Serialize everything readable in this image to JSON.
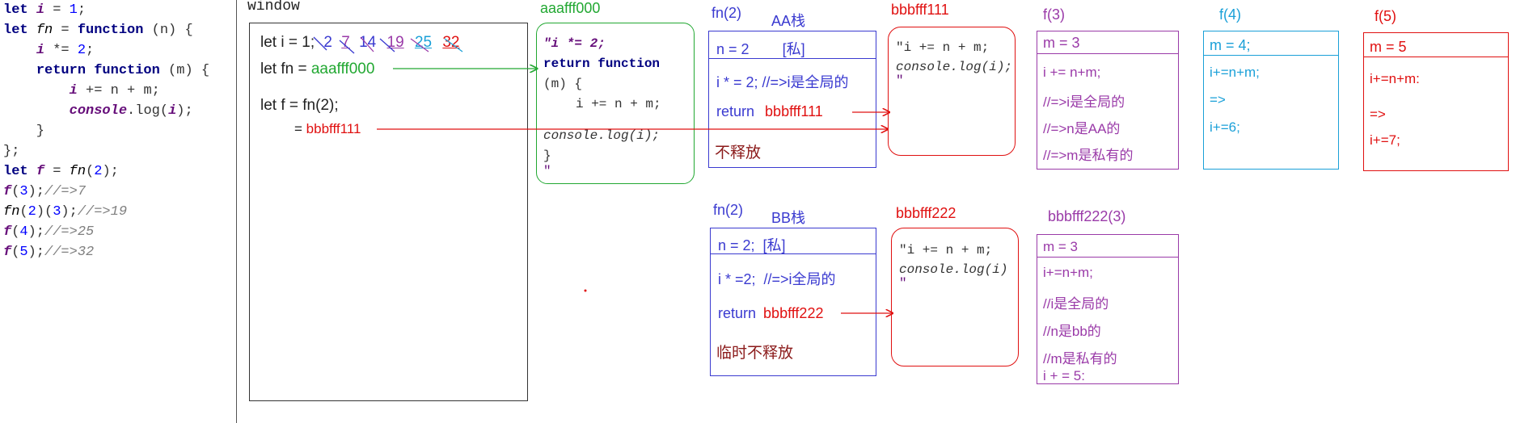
{
  "colors": {
    "blue": "#3a3ad0",
    "red": "#e01010",
    "green": "#22a832",
    "purple": "#9a3aa8",
    "cyan": "#1aa0d8",
    "dark_red": "#8b1a1a"
  },
  "code": [
    {
      "t": [
        "let ",
        {
          "v": "i"
        },
        " = ",
        {
          "n": "1"
        },
        ";"
      ]
    },
    {
      "t": [
        "let ",
        {
          "f": "fn"
        },
        " = ",
        {
          "k": "function"
        },
        " (n) {"
      ]
    },
    {
      "t": [
        "    ",
        {
          "v": "i"
        },
        " *= ",
        {
          "n": "2"
        },
        ";"
      ]
    },
    {
      "t": [
        "    ",
        {
          "k": "return function"
        },
        " (m) {"
      ]
    },
    {
      "t": [
        "        ",
        {
          "v": "i"
        },
        " += n + m;"
      ]
    },
    {
      "t": [
        "        ",
        {
          "v": "console"
        },
        ".log(",
        {
          "v": "i"
        },
        ");"
      ]
    },
    {
      "t": [
        "    }"
      ]
    },
    {
      "t": [
        "};"
      ]
    },
    {
      "t": [
        "let ",
        {
          "v": "f"
        },
        " = ",
        {
          "f": "fn"
        },
        "(",
        {
          "n": "2"
        },
        ");"
      ]
    },
    {
      "t": [
        {
          "v": "f"
        },
        "(",
        {
          "n": "3"
        },
        ");",
        {
          "c": "//=>7"
        }
      ]
    },
    {
      "t": [
        {
          "f": "fn"
        },
        "(",
        {
          "n": "2"
        },
        ")(",
        {
          "n": "3"
        },
        ");",
        {
          "c": "//=>19"
        }
      ]
    },
    {
      "t": [
        {
          "v": "f"
        },
        "(",
        {
          "n": "4"
        },
        ");",
        {
          "c": "//=>25"
        }
      ]
    },
    {
      "t": [
        {
          "v": "f"
        },
        "(",
        {
          "n": "5"
        },
        ");",
        {
          "c": "//=>32"
        }
      ]
    }
  ],
  "window": {
    "label": "window",
    "let_i": "let i = ",
    "i_values": [
      "1",
      "2",
      "7",
      "14",
      "19",
      "25",
      "32"
    ],
    "let_fn": "let fn = ",
    "fn_ref": "aaafff000",
    "let_f": "let f = fn(2);",
    "eq": "=",
    "f_ref": "bbbfff111"
  },
  "heap_aaafff000": {
    "title": "aaafff000",
    "l1": "\"i *= 2;",
    "l2": "return function",
    "l3": "(m)  {",
    "l4": "i += n + m;",
    "l5": "console.log(i);",
    "l6": "}",
    "l7": "\""
  },
  "fn2_aa": {
    "title": "fn(2)",
    "stack": "AA栈",
    "row1": "n = 2",
    "row1b": "[私]",
    "row2": "i * = 2; //=>i是全局的",
    "row3": "return",
    "ref": "bbbfff111",
    "row4": "不释放"
  },
  "heap_bbbfff111": {
    "title": "bbbfff111",
    "l1": "\"i += n + m;",
    "l2": "console.log(i);",
    "l3": "\""
  },
  "f3": {
    "title": "f(3)",
    "rows": [
      "m = 3",
      "i += n+m;",
      "//=>i是全局的",
      "//=>n是AA的",
      "//=>m是私有的"
    ]
  },
  "f4": {
    "title": "f(4)",
    "rows": [
      "m = 4;",
      "i+=n+m;",
      "=>",
      "i+=6;"
    ]
  },
  "f5": {
    "title": "f(5)",
    "rows": [
      "m = 5",
      "i+=n+m:",
      "=>",
      "i+=7;"
    ]
  },
  "fn2_bb": {
    "title": "fn(2)",
    "stack": "BB栈",
    "row1": "n = 2;  [私]",
    "row2": "i * =2;  //=>i全局的",
    "row3": "return",
    "ref": "bbbfff222",
    "row4": "临时不释放"
  },
  "heap_bbbfff222": {
    "title": "bbbfff222",
    "l1": "\"i += n + m;",
    "l2": "console.log(i)",
    "l3": "\""
  },
  "bbbfff222_3": {
    "title": "bbbfff222(3)",
    "rows": [
      "m = 3",
      "i+=n+m;",
      "//i是全局的",
      "//n是bb的",
      "//m是私有的",
      "i + = 5:"
    ]
  }
}
